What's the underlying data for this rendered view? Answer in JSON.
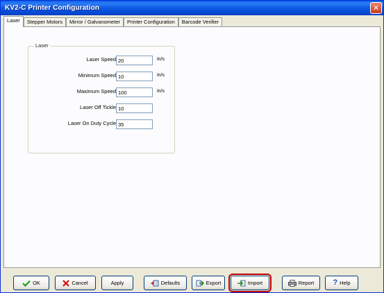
{
  "window": {
    "title": "KV2-C Printer Configuration"
  },
  "tabs": [
    {
      "label": "Laser"
    },
    {
      "label": "Stepper Motors"
    },
    {
      "label": "Mirror / Galvanometer"
    },
    {
      "label": "Printer Configuration"
    },
    {
      "label": "Barcode Verifier"
    }
  ],
  "laser_group": {
    "label": "Laser",
    "fields": [
      {
        "label": "Laser Speed",
        "value": "20",
        "unit": "in/s"
      },
      {
        "label": "Minimum Speed",
        "value": "10",
        "unit": "in/s"
      },
      {
        "label": "Maximum Speed",
        "value": "100",
        "unit": "in/s"
      },
      {
        "label": "Laser Off Tickle",
        "value": "10",
        "unit": ""
      },
      {
        "label": "Laser On Duty Cycle",
        "value": "35",
        "unit": ""
      }
    ]
  },
  "buttons": {
    "ok": "OK",
    "cancel": "Cancel",
    "apply": "Apply",
    "defaults": "Defaults",
    "export": "Export",
    "import": "Import",
    "report": "Report",
    "help": "Help"
  },
  "colors": {
    "highlight": "#c00000",
    "title_bar": "#0a56e2"
  }
}
